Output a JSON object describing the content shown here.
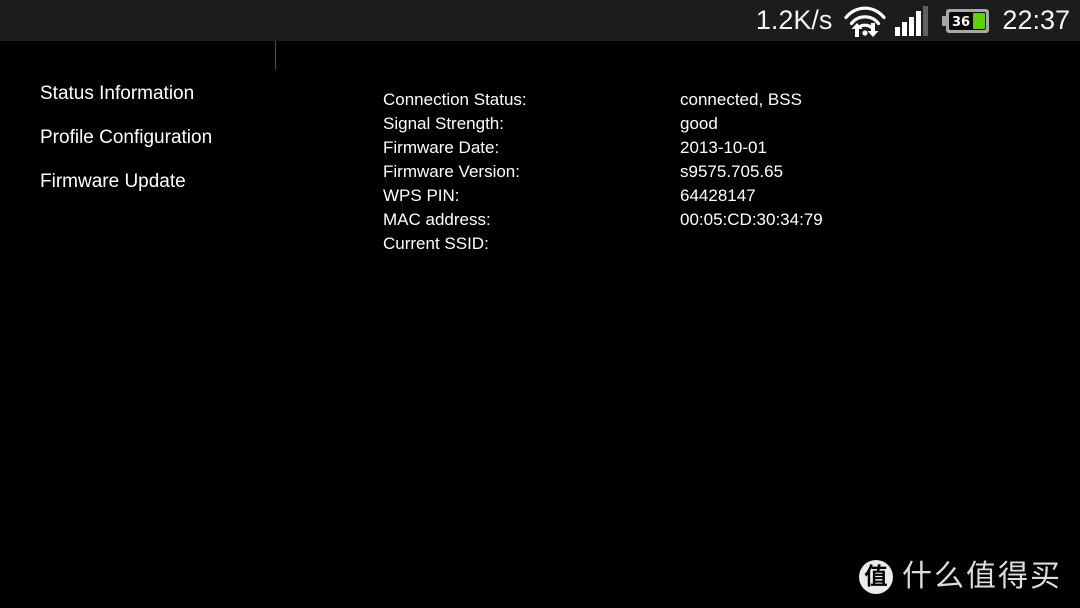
{
  "status_bar": {
    "network_speed": "1.2K/s",
    "wifi_icon": "wifi-with-transfer-arrows-icon",
    "signal_icon": "cellular-signal-icon",
    "signal_bars_active": 4,
    "signal_bars_total": 5,
    "battery_level": "36",
    "battery_color": "#5fd000",
    "clock": "22:37",
    "background_color": "#1c1c1c"
  },
  "sidebar": {
    "items": [
      {
        "label": "Status Information"
      },
      {
        "label": "Profile Configuration"
      },
      {
        "label": "Firmware Update"
      }
    ]
  },
  "info_panel": {
    "rows": [
      {
        "label": "Connection Status:",
        "value": "connected, BSS"
      },
      {
        "label": "Signal Strength:",
        "value": "good"
      },
      {
        "label": "Firmware Date:",
        "value": "2013-10-01"
      },
      {
        "label": "Firmware Version:",
        "value": "s9575.705.65"
      },
      {
        "label": "WPS PIN:",
        "value": "64428147"
      },
      {
        "label": "MAC address:",
        "value": "00:05:CD:30:34:79"
      },
      {
        "label": "Current SSID:",
        "value": ""
      }
    ]
  },
  "watermark": {
    "logo_glyph": "值",
    "text": "什么值得买"
  }
}
